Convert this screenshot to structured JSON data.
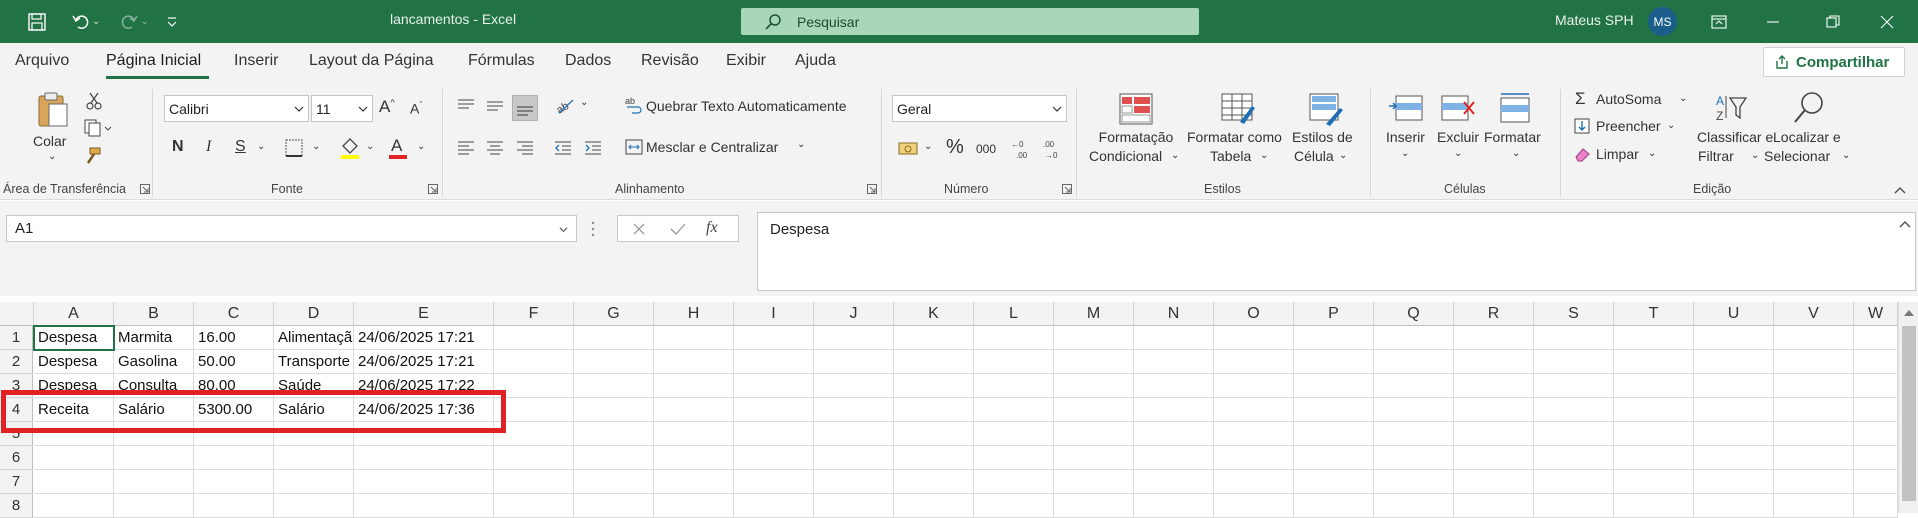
{
  "titlebar": {
    "title": "lancamentos  -  Excel",
    "search_placeholder": "Pesquisar",
    "user_name": "Mateus SPH",
    "user_initials": "MS",
    "accent": "#217346"
  },
  "menu": {
    "tabs": [
      "Arquivo",
      "Página Inicial",
      "Inserir",
      "Layout da Página",
      "Fórmulas",
      "Dados",
      "Revisão",
      "Exibir",
      "Ajuda"
    ],
    "active_tab": "Página Inicial",
    "share_label": "Compartilhar"
  },
  "ribbon": {
    "clipboard": {
      "paste_label": "Colar",
      "group_label": "Área de Transferência"
    },
    "font": {
      "font_name": "Calibri",
      "font_size": "11",
      "bold": "N",
      "italic": "I",
      "underline": "S",
      "group_label": "Fonte"
    },
    "alignment": {
      "wrap_text": "Quebrar Texto Automaticamente",
      "merge_center": "Mesclar e Centralizar",
      "group_label": "Alinhamento"
    },
    "number": {
      "format": "Geral",
      "percent": "%",
      "thousands": "000",
      "group_label": "Número"
    },
    "styles": {
      "cond_format_1": "Formatação",
      "cond_format_2": "Condicional",
      "table_format_1": "Formatar como",
      "table_format_2": "Tabela",
      "cell_styles_1": "Estilos de",
      "cell_styles_2": "Célula",
      "group_label": "Estilos"
    },
    "cells": {
      "insert": "Inserir",
      "delete": "Excluir",
      "format": "Formatar",
      "group_label": "Células"
    },
    "editing": {
      "autosum": "AutoSoma",
      "fill": "Preencher",
      "clear": "Limpar",
      "sort_1": "Classificar e",
      "sort_2": "Filtrar",
      "find_1": "Localizar e",
      "find_2": "Selecionar",
      "group_label": "Edição"
    }
  },
  "formula_bar": {
    "name_box": "A1",
    "fx": "fx",
    "content": "Despesa"
  },
  "grid": {
    "columns": [
      "A",
      "B",
      "C",
      "D",
      "E",
      "F",
      "G",
      "H",
      "I",
      "J",
      "K",
      "L",
      "M",
      "N",
      "O",
      "P",
      "Q",
      "R",
      "S",
      "T",
      "U",
      "V",
      "W"
    ],
    "row_numbers": [
      "1",
      "2",
      "3",
      "4",
      "5",
      "6",
      "7",
      "8"
    ],
    "rows": [
      [
        "Despesa",
        "Marmita",
        "16.00",
        "Alimentaçã",
        "24/06/2025 17:21"
      ],
      [
        "Despesa",
        "Gasolina",
        "50.00",
        "Transporte",
        "24/06/2025 17:21"
      ],
      [
        "Despesa",
        "Consulta",
        "80.00",
        "Saúde",
        "24/06/2025 17:22"
      ],
      [
        "Receita",
        "Salário",
        "5300.00",
        "Salário",
        "24/06/2025 17:36"
      ]
    ],
    "highlight_color": "#e02222"
  }
}
